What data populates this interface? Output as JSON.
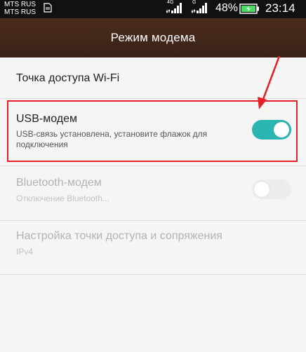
{
  "status_bar": {
    "carrier_1": "MTS RUS",
    "carrier_2": "MTS RUS",
    "net_type_1": "4G",
    "net_type_2": "G",
    "battery_percent": "48%",
    "time": "23:14",
    "icons": [
      "sim-card-icon",
      "signal-icon",
      "battery-charging-icon"
    ]
  },
  "header": {
    "title": "Режим модема"
  },
  "items": [
    {
      "title": "Точка доступа Wi-Fi",
      "enabled": true
    },
    {
      "title": "USB-модем",
      "subtitle": "USB-связь установлена, установите флажок для подключения",
      "toggle_on": true,
      "enabled": true
    },
    {
      "title": "Bluetooth-модем",
      "subtitle": "Отключение Bluetooth...",
      "toggle_on": false,
      "enabled": false
    },
    {
      "title": "Настройка точки доступа и сопряжения",
      "subtitle": "IPv4",
      "enabled": false
    }
  ],
  "colors": {
    "header_bg": "#4a2c1e",
    "toggle_on": "#2bb5b0",
    "highlight": "#e3202a"
  }
}
